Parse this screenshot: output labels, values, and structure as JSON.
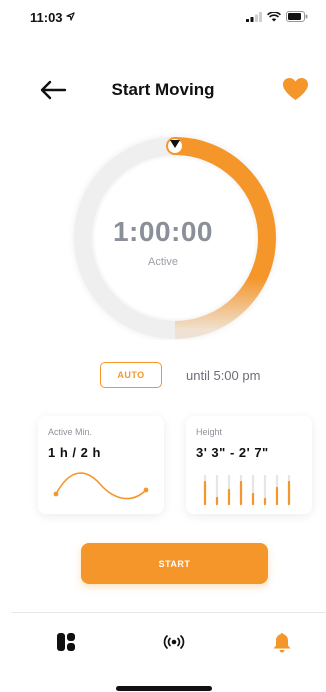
{
  "status_bar": {
    "time": "11:03",
    "icons": [
      "location-arrow-icon",
      "signal-icon",
      "wifi-icon",
      "battery-icon"
    ]
  },
  "header": {
    "title": "Start Moving",
    "back_icon": "arrow-left-icon",
    "favorite_icon": "heart-icon"
  },
  "timer": {
    "value": "1:00:00",
    "label": "Active",
    "progress_fraction": 0.5
  },
  "mode": {
    "auto_label": "AUTO",
    "until_text": "until 5:00 pm"
  },
  "cards": [
    {
      "label": "Active Min.",
      "value": "1 h / 2 h",
      "graphic": "wave-curve"
    },
    {
      "label": "Height",
      "value": "3' 3\" - 2' 7\"",
      "graphic": "height-bars"
    }
  ],
  "start_button": {
    "label": "START"
  },
  "tabbar": {
    "items": [
      {
        "icon": "dashboard-icon",
        "active": false
      },
      {
        "icon": "broadcast-icon",
        "active": false
      },
      {
        "icon": "bell-icon",
        "active": true
      }
    ]
  },
  "colors": {
    "accent": "#f5962a",
    "track": "#eeeeee",
    "text_primary": "#111111",
    "text_secondary": "#8a8f9a"
  }
}
